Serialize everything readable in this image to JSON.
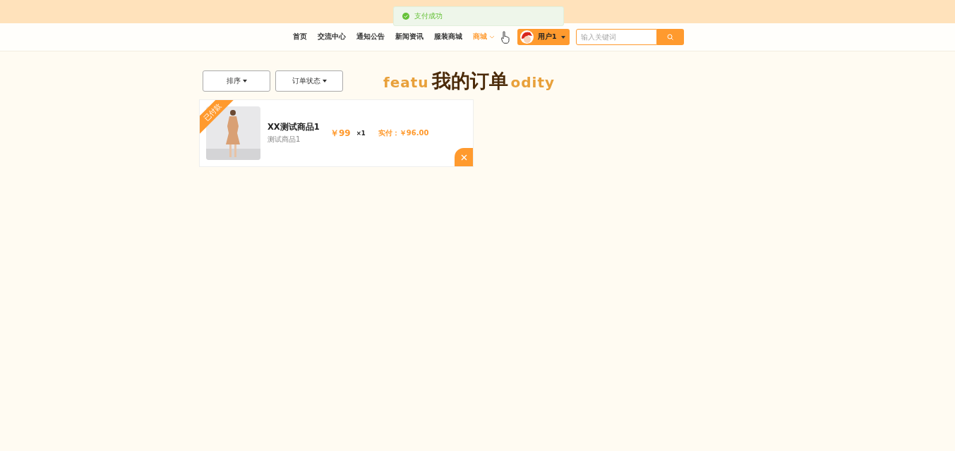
{
  "toast": {
    "text": "支付成功"
  },
  "nav": {
    "items": [
      {
        "label": "首页",
        "selected": false
      },
      {
        "label": "交流中心",
        "selected": false
      },
      {
        "label": "通知公告",
        "selected": false
      },
      {
        "label": "新闻资讯",
        "selected": false
      },
      {
        "label": "服装商城",
        "selected": false
      },
      {
        "label": "商城",
        "selected": true
      }
    ],
    "user": {
      "name": "用户1"
    },
    "search": {
      "placeholder": "输入关键词"
    }
  },
  "filters": [
    {
      "label": "排序"
    },
    {
      "label": "订单状态"
    }
  ],
  "heading": {
    "title": "我的订单",
    "subtitle_left": "featu",
    "subtitle_right": "odity"
  },
  "orders": [
    {
      "status": "已付款",
      "name": "XX测试商品1",
      "description": "测试商品1",
      "price": "￥99",
      "quantity": "×1",
      "paid": "实付：￥96.00"
    }
  ]
}
